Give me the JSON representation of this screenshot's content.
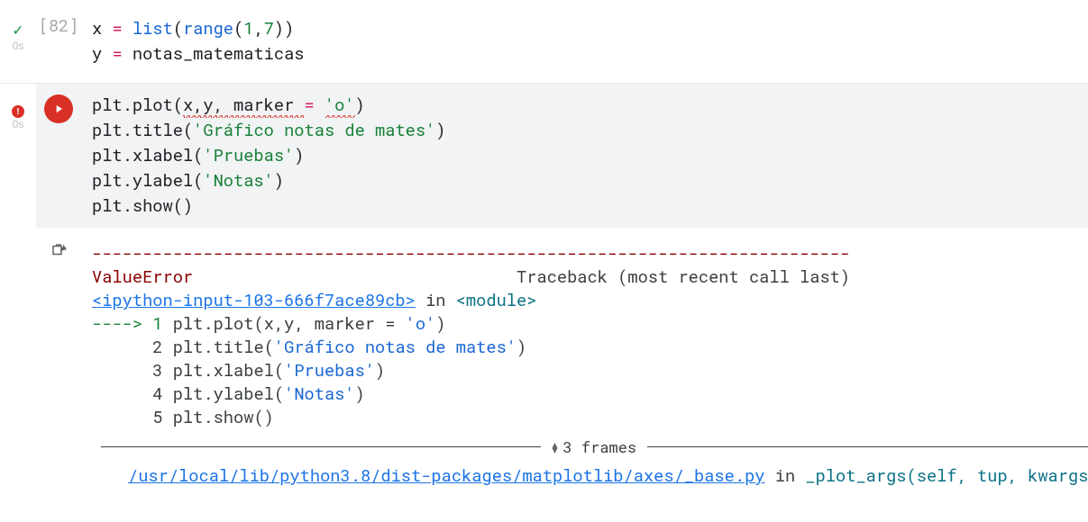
{
  "cell1": {
    "exec_count": "[82]",
    "status_icon": "check",
    "runtime": "0s",
    "code_tokens": [
      {
        "t": "x ",
        "c": "py-var"
      },
      {
        "t": "= ",
        "c": "py-op"
      },
      {
        "t": "list",
        "c": "py-fn"
      },
      {
        "t": "(",
        "c": "py-var"
      },
      {
        "t": "range",
        "c": "py-fn"
      },
      {
        "t": "(",
        "c": "py-var"
      },
      {
        "t": "1",
        "c": "py-num"
      },
      {
        "t": ",",
        "c": "py-var"
      },
      {
        "t": "7",
        "c": "py-num"
      },
      {
        "t": "))",
        "c": "py-var"
      },
      {
        "nl": true
      },
      {
        "t": "y ",
        "c": "py-var"
      },
      {
        "t": "= ",
        "c": "py-op"
      },
      {
        "t": "notas_matematicas",
        "c": "py-var"
      }
    ]
  },
  "cell2": {
    "status_icon": "error",
    "runtime": "0s",
    "code_tokens": [
      {
        "t": "plt",
        "c": "py-var"
      },
      {
        "t": ".",
        "c": "py-var"
      },
      {
        "t": "plot",
        "c": "py-var"
      },
      {
        "t": "(",
        "c": "py-var"
      },
      {
        "t": "x,y, marker ",
        "c": "py-var py-squiggle"
      },
      {
        "t": "= ",
        "c": "py-op"
      },
      {
        "t": "'o'",
        "c": "py-str py-squiggle"
      },
      {
        "t": ")",
        "c": "py-var"
      },
      {
        "nl": true
      },
      {
        "t": "plt.title(",
        "c": "py-var"
      },
      {
        "t": "'Gráfico notas de mates'",
        "c": "py-str"
      },
      {
        "t": ")",
        "c": "py-var"
      },
      {
        "nl": true
      },
      {
        "t": "plt.xlabel(",
        "c": "py-var"
      },
      {
        "t": "'Pruebas'",
        "c": "py-str"
      },
      {
        "t": ")",
        "c": "py-var"
      },
      {
        "nl": true
      },
      {
        "t": "plt.ylabel(",
        "c": "py-var"
      },
      {
        "t": "'Notas'",
        "c": "py-str"
      },
      {
        "t": ")",
        "c": "py-var"
      },
      {
        "nl": true
      },
      {
        "t": "plt.show()",
        "c": "py-var"
      }
    ]
  },
  "output": {
    "separator": "---------------------------------------------------------------------------",
    "error_name": "ValueError",
    "traceback_label": "Traceback (most recent call last)",
    "link1": "<ipython-input-103-666f7ace89cb>",
    "in_word": " in ",
    "module_word": "<module>",
    "arrow": "----> 1 ",
    "lines": [
      {
        "n": "1",
        "code": [
          {
            "t": "plt",
            "c": "tb-plain"
          },
          {
            "t": ".",
            "c": "tb-plain"
          },
          {
            "t": "plot",
            "c": "tb-plain"
          },
          {
            "t": "(x,y, marker ",
            "c": "tb-plain"
          },
          {
            "t": "=",
            "c": "tb-plain"
          },
          {
            "t": " ",
            "c": "tb-plain"
          },
          {
            "t": "'o'",
            "c": "tb-str"
          },
          {
            "t": ")",
            "c": "tb-plain"
          }
        ]
      },
      {
        "n": "2",
        "code": [
          {
            "t": "plt",
            "c": "tb-plain"
          },
          {
            "t": ".",
            "c": "tb-plain"
          },
          {
            "t": "title",
            "c": "tb-plain"
          },
          {
            "t": "(",
            "c": "tb-plain"
          },
          {
            "t": "'Gráfico notas de mates'",
            "c": "tb-str"
          },
          {
            "t": ")",
            "c": "tb-plain"
          }
        ]
      },
      {
        "n": "3",
        "code": [
          {
            "t": "plt",
            "c": "tb-plain"
          },
          {
            "t": ".",
            "c": "tb-plain"
          },
          {
            "t": "xlabel",
            "c": "tb-plain"
          },
          {
            "t": "(",
            "c": "tb-plain"
          },
          {
            "t": "'Pruebas'",
            "c": "tb-str"
          },
          {
            "t": ")",
            "c": "tb-plain"
          }
        ]
      },
      {
        "n": "4",
        "code": [
          {
            "t": "plt",
            "c": "tb-plain"
          },
          {
            "t": ".",
            "c": "tb-plain"
          },
          {
            "t": "ylabel",
            "c": "tb-plain"
          },
          {
            "t": "(",
            "c": "tb-plain"
          },
          {
            "t": "'Notas'",
            "c": "tb-str"
          },
          {
            "t": ")",
            "c": "tb-plain"
          }
        ]
      },
      {
        "n": "5",
        "code": [
          {
            "t": "plt",
            "c": "tb-plain"
          },
          {
            "t": ".",
            "c": "tb-plain"
          },
          {
            "t": "show",
            "c": "tb-plain"
          },
          {
            "t": "()",
            "c": "tb-plain"
          }
        ]
      }
    ],
    "frames_label": "3 frames",
    "bottom_tokens": [
      {
        "t": "/usr/local/lib/python3.8/dist-packages/matplotlib/axes/_base.py",
        "c": "tb-link"
      },
      {
        "t": " in ",
        "c": "tb-plain"
      },
      {
        "t": "_plot_args",
        "c": "tb-cyan"
      },
      {
        "t": "(self, tup, kwargs)",
        "c": "tb-cyan"
      }
    ]
  }
}
